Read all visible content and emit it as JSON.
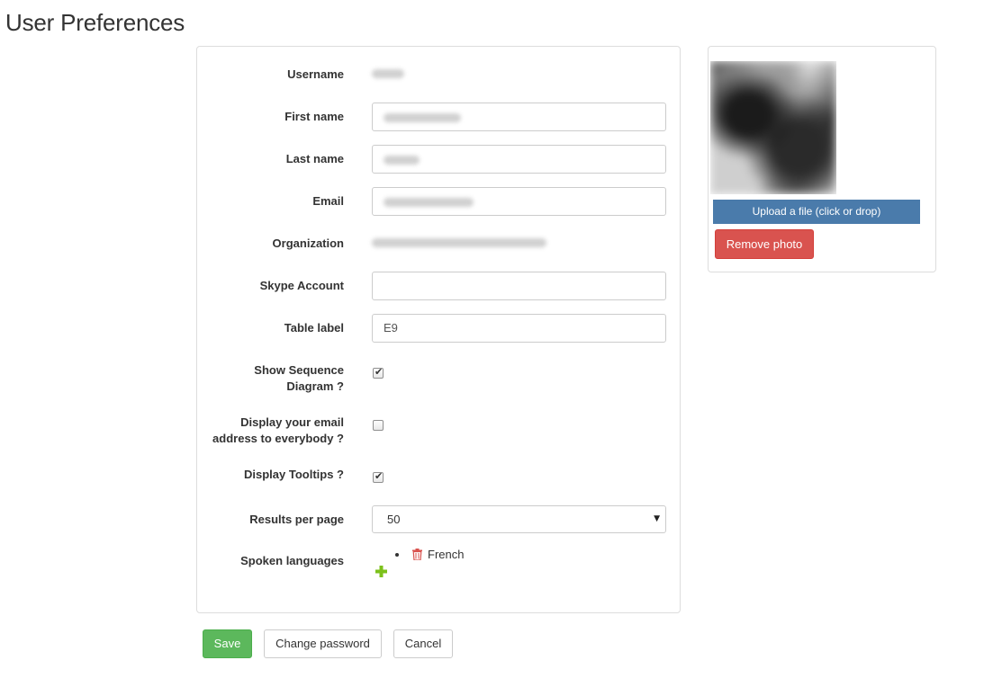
{
  "page": {
    "title": "User Preferences"
  },
  "form": {
    "username": {
      "label": "Username",
      "value": ""
    },
    "first_name": {
      "label": "First name",
      "value": ""
    },
    "last_name": {
      "label": "Last name",
      "value": ""
    },
    "email": {
      "label": "Email",
      "value": ""
    },
    "organization": {
      "label": "Organization",
      "value": ""
    },
    "skype": {
      "label": "Skype Account",
      "value": ""
    },
    "table_label": {
      "label": "Table label",
      "value": "E9"
    },
    "show_sequence": {
      "label_line1": "Show Sequence",
      "label_line2": "Diagram ?",
      "checked": true
    },
    "display_email": {
      "label_line1": "Display your email",
      "label_line2": "address to everybody ?",
      "checked": false
    },
    "display_tooltips": {
      "label": "Display Tooltips ?",
      "checked": true
    },
    "results_per_page": {
      "label": "Results per page",
      "selected": "50",
      "caret": "▼"
    },
    "spoken_languages": {
      "label": "Spoken languages",
      "items": [
        {
          "name": "French"
        }
      ]
    }
  },
  "photo": {
    "upload_label": "Upload a file (click or drop)",
    "remove_label": "Remove photo"
  },
  "actions": {
    "save_label": "Save",
    "change_password_label": "Change password",
    "cancel_label": "Cancel"
  },
  "colors": {
    "save": "#5cb85c",
    "upload": "#4a7bab",
    "remove": "#d9534f",
    "trash_icon": "#d9534f",
    "add_icon": "#7cc11b"
  },
  "icons": {
    "delete_language": "trash-icon",
    "add_language": "plus-icon"
  }
}
